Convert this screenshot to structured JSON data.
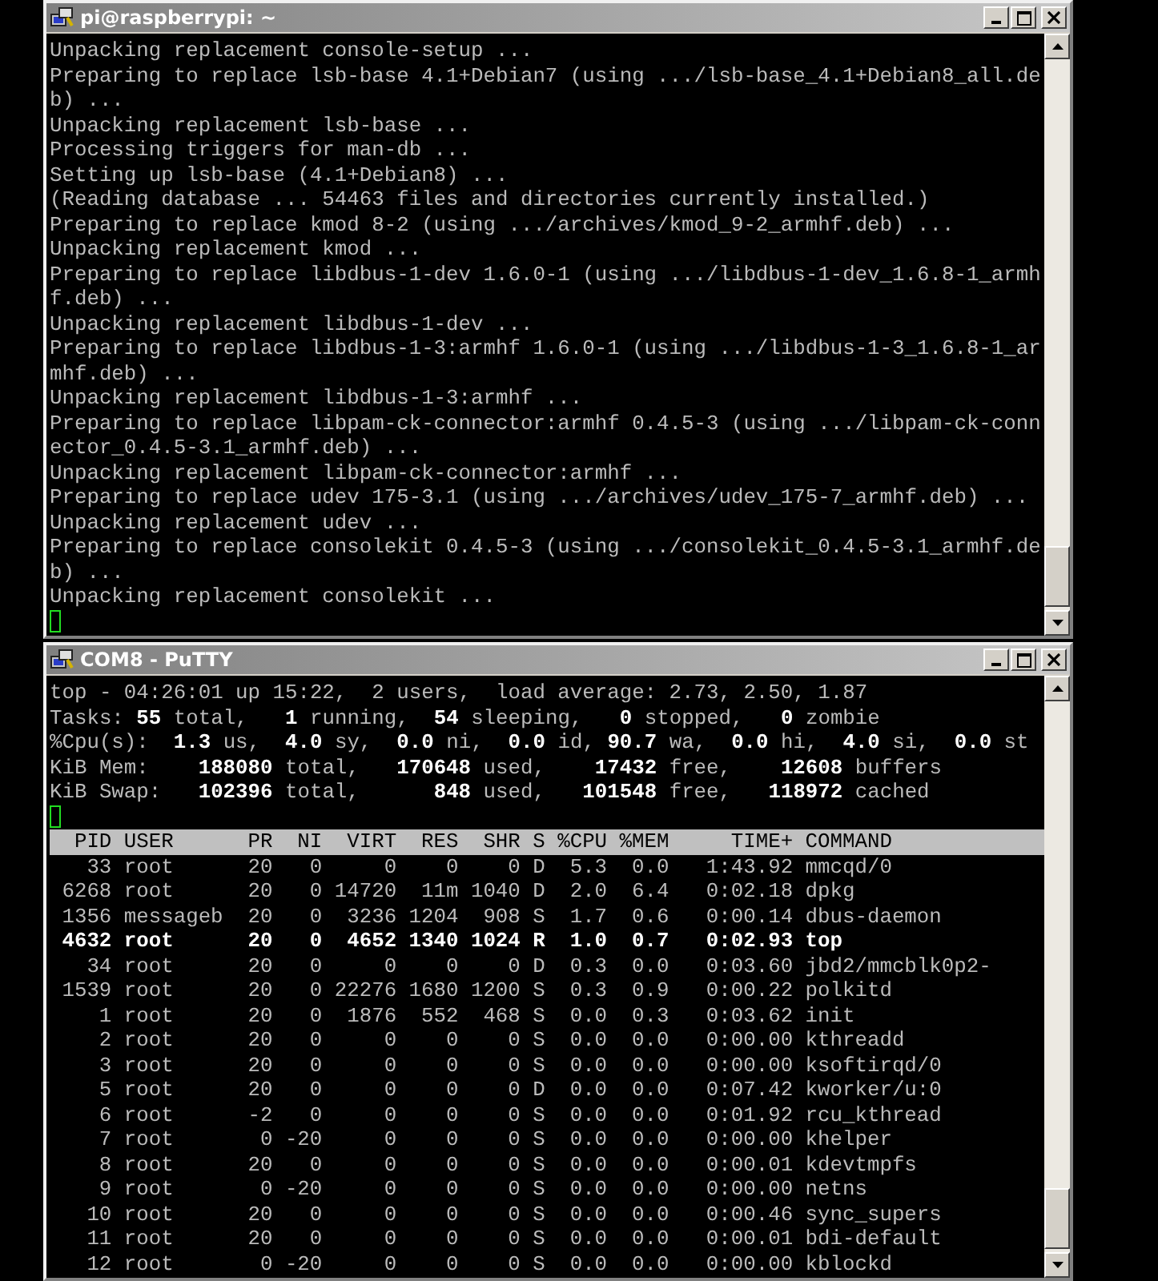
{
  "windows": [
    {
      "kind": "log",
      "title": "pi@raspberrypi: ~",
      "cursor": true,
      "lines": [
        "Unpacking replacement console-setup ...",
        "Preparing to replace lsb-base 4.1+Debian7 (using .../lsb-base_4.1+Debian8_all.de",
        "b) ...",
        "Unpacking replacement lsb-base ...",
        "Processing triggers for man-db ...",
        "Setting up lsb-base (4.1+Debian8) ...",
        "(Reading database ... 54463 files and directories currently installed.)",
        "Preparing to replace kmod 8-2 (using .../archives/kmod_9-2_armhf.deb) ...",
        "Unpacking replacement kmod ...",
        "Preparing to replace libdbus-1-dev 1.6.0-1 (using .../libdbus-1-dev_1.6.8-1_armh",
        "f.deb) ...",
        "Unpacking replacement libdbus-1-dev ...",
        "Preparing to replace libdbus-1-3:armhf 1.6.0-1 (using .../libdbus-1-3_1.6.8-1_ar",
        "mhf.deb) ...",
        "Unpacking replacement libdbus-1-3:armhf ...",
        "Preparing to replace libpam-ck-connector:armhf 0.4.5-3 (using .../libpam-ck-conn",
        "ector_0.4.5-3.1_armhf.deb) ...",
        "Unpacking replacement libpam-ck-connector:armhf ...",
        "Preparing to replace udev 175-3.1 (using .../archives/udev_175-7_armhf.deb) ...",
        "Unpacking replacement udev ...",
        "Preparing to replace consolekit 0.4.5-3 (using .../consolekit_0.4.5-3.1_armhf.de",
        "b) ...",
        "Unpacking replacement consolekit ..."
      ]
    },
    {
      "kind": "top",
      "title": "COM8 - PuTTY",
      "cursor": true,
      "summary": [
        "top - 04:26:01 up 15:22,  2 users,  load average: 2.73, 2.50, 1.87",
        "Tasks: **55** total,   **1** running,  **54** sleeping,   **0** stopped,   **0** zombie",
        "%Cpu(s):  **1.3** us,  **4.0** sy,  **0.0** ni,  **0.0** id, **90.7** wa,  **0.0** hi,  **4.0** si,  **0.0** st",
        "KiB Mem:    **188080** total,   **170648** used,    **17432** free,    **12608** buffers",
        "KiB Swap:   **102396** total,      **848** used,   **101548** free,   **118972** cached"
      ],
      "table": {
        "columns": [
          "PID",
          "USER",
          "PR",
          "NI",
          "VIRT",
          "RES",
          "SHR",
          "S",
          "%CPU",
          "%MEM",
          "TIME+",
          "COMMAND"
        ],
        "rows": [
          {
            "highlighted": false,
            "cells": [
              "33",
              "root",
              "20",
              "0",
              "0",
              "0",
              "0",
              "D",
              "5.3",
              "0.0",
              "1:43.92",
              "mmcqd/0"
            ]
          },
          {
            "highlighted": false,
            "cells": [
              "6268",
              "root",
              "20",
              "0",
              "14720",
              "11m",
              "1040",
              "D",
              "2.0",
              "6.4",
              "0:02.18",
              "dpkg"
            ]
          },
          {
            "highlighted": false,
            "cells": [
              "1356",
              "messageb",
              "20",
              "0",
              "3236",
              "1204",
              "908",
              "S",
              "1.7",
              "0.6",
              "0:00.14",
              "dbus-daemon"
            ]
          },
          {
            "highlighted": true,
            "cells": [
              "4632",
              "root",
              "20",
              "0",
              "4652",
              "1340",
              "1024",
              "R",
              "1.0",
              "0.7",
              "0:02.93",
              "top"
            ]
          },
          {
            "highlighted": false,
            "cells": [
              "34",
              "root",
              "20",
              "0",
              "0",
              "0",
              "0",
              "D",
              "0.3",
              "0.0",
              "0:03.60",
              "jbd2/mmcblk0p2-"
            ]
          },
          {
            "highlighted": false,
            "cells": [
              "1539",
              "root",
              "20",
              "0",
              "22276",
              "1680",
              "1200",
              "S",
              "0.3",
              "0.9",
              "0:00.22",
              "polkitd"
            ]
          },
          {
            "highlighted": false,
            "cells": [
              "1",
              "root",
              "20",
              "0",
              "1876",
              "552",
              "468",
              "S",
              "0.0",
              "0.3",
              "0:03.62",
              "init"
            ]
          },
          {
            "highlighted": false,
            "cells": [
              "2",
              "root",
              "20",
              "0",
              "0",
              "0",
              "0",
              "S",
              "0.0",
              "0.0",
              "0:00.00",
              "kthreadd"
            ]
          },
          {
            "highlighted": false,
            "cells": [
              "3",
              "root",
              "20",
              "0",
              "0",
              "0",
              "0",
              "S",
              "0.0",
              "0.0",
              "0:00.00",
              "ksoftirqd/0"
            ]
          },
          {
            "highlighted": false,
            "cells": [
              "5",
              "root",
              "20",
              "0",
              "0",
              "0",
              "0",
              "D",
              "0.0",
              "0.0",
              "0:07.42",
              "kworker/u:0"
            ]
          },
          {
            "highlighted": false,
            "cells": [
              "6",
              "root",
              "-2",
              "0",
              "0",
              "0",
              "0",
              "S",
              "0.0",
              "0.0",
              "0:01.92",
              "rcu_kthread"
            ]
          },
          {
            "highlighted": false,
            "cells": [
              "7",
              "root",
              "0",
              "-20",
              "0",
              "0",
              "0",
              "S",
              "0.0",
              "0.0",
              "0:00.00",
              "khelper"
            ]
          },
          {
            "highlighted": false,
            "cells": [
              "8",
              "root",
              "20",
              "0",
              "0",
              "0",
              "0",
              "S",
              "0.0",
              "0.0",
              "0:00.01",
              "kdevtmpfs"
            ]
          },
          {
            "highlighted": false,
            "cells": [
              "9",
              "root",
              "0",
              "-20",
              "0",
              "0",
              "0",
              "S",
              "0.0",
              "0.0",
              "0:00.00",
              "netns"
            ]
          },
          {
            "highlighted": false,
            "cells": [
              "10",
              "root",
              "20",
              "0",
              "0",
              "0",
              "0",
              "S",
              "0.0",
              "0.0",
              "0:00.46",
              "sync_supers"
            ]
          },
          {
            "highlighted": false,
            "cells": [
              "11",
              "root",
              "20",
              "0",
              "0",
              "0",
              "0",
              "S",
              "0.0",
              "0.0",
              "0:00.01",
              "bdi-default"
            ]
          },
          {
            "highlighted": false,
            "cells": [
              "12",
              "root",
              "0",
              "-20",
              "0",
              "0",
              "0",
              "S",
              "0.0",
              "0.0",
              "0:00.00",
              "kblockd"
            ]
          }
        ]
      }
    }
  ]
}
